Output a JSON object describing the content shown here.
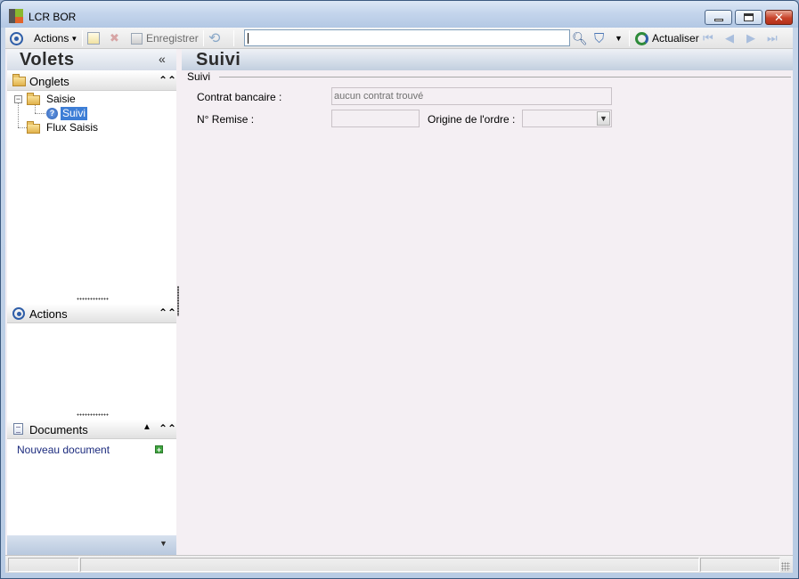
{
  "window": {
    "title": "LCR BOR"
  },
  "toolbar": {
    "actions_label": "Actions",
    "save_label": "Enregistrer",
    "search_value": "",
    "refresh_label": "Actualiser"
  },
  "left_panel": {
    "title": "Volets",
    "tabs_section": {
      "label": "Onglets",
      "tree": [
        {
          "label": "Saisie",
          "children": [
            {
              "label": "Suivi",
              "selected": true
            }
          ]
        },
        {
          "label": "Flux Saisis",
          "children": []
        }
      ]
    },
    "actions_section": {
      "label": "Actions"
    },
    "documents_section": {
      "label": "Documents",
      "new_document_label": "Nouveau document"
    }
  },
  "content": {
    "title": "Suivi",
    "group_label": "Suivi",
    "fields": {
      "contrat_label": "Contrat bancaire :",
      "contrat_value": "aucun contrat trouvé",
      "remise_label": "N° Remise :",
      "remise_value": "",
      "origine_label": "Origine de l'ordre :",
      "origine_value": ""
    }
  },
  "statusbar": {
    "cells": [
      "",
      "",
      ""
    ]
  },
  "colors": {
    "accent": "#2f5ea8",
    "selection": "#3d7ed6",
    "content_bg": "#f4eff3",
    "link": "#1c2b7e"
  }
}
